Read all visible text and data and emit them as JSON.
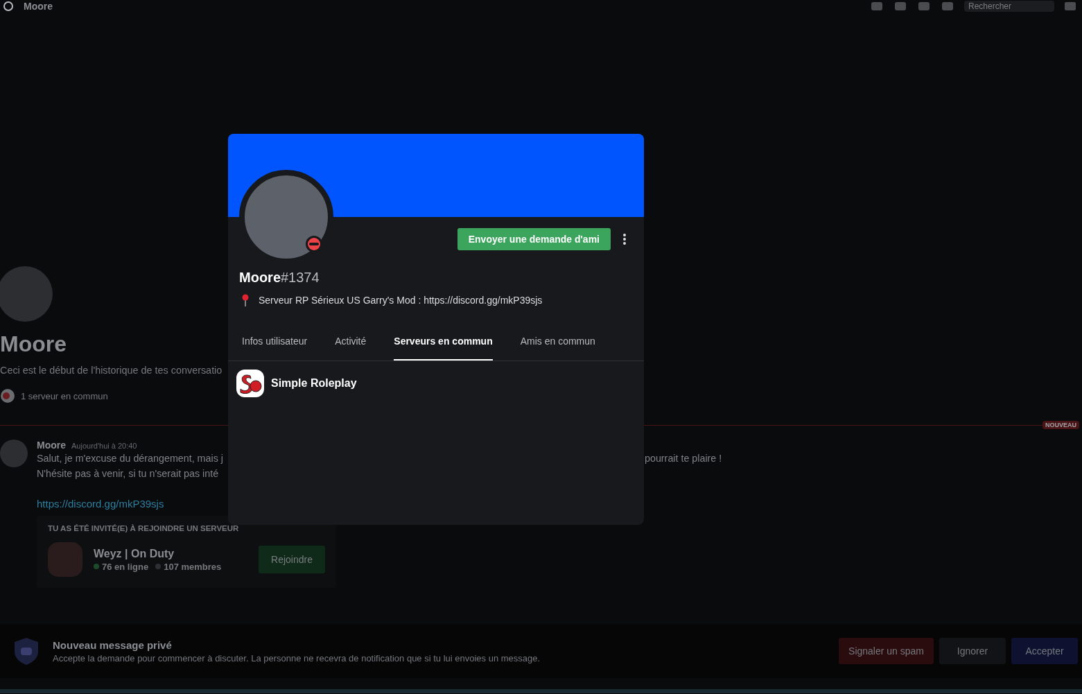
{
  "header": {
    "title": "Moore",
    "search": {
      "placeholder": "Rechercher"
    }
  },
  "dm_intro": {
    "name": "Moore",
    "description": "Ceci est le début de l'historique de tes conversatio",
    "mutual": "1 serveur en commun"
  },
  "divider_badge": "NOUVEAU",
  "message": {
    "author": "Moore",
    "time": "Aujourd'hui à 20:40",
    "lines": [
      {
        "left": "Salut, je m'excuse du dérangement, mais j",
        "right": "pourrait te plaire !"
      },
      {
        "left": "N'hésite pas à venir, si tu n'serait pas inté"
      }
    ],
    "link": "https://discord.gg/mkP39sjs",
    "invite": {
      "heading": "TU AS ÉTÉ INVITÉ(E) À REJOINDRE UN SERVEUR",
      "server": "Weyz | On Duty",
      "online": "76 en ligne",
      "members": "107 membres",
      "button": "Rejoindre"
    }
  },
  "request_bar": {
    "title": "Nouveau message privé",
    "text": "Accepte la demande pour commencer à discuter. La personne ne recevra de notification que si tu lui envoies un message.",
    "buttons": [
      {
        "label": "Signaler un spam",
        "kind": "danger"
      },
      {
        "label": "Ignorer",
        "kind": "secondary"
      },
      {
        "label": "Accepter",
        "kind": "primary"
      }
    ]
  },
  "profile": {
    "do_not_disturb": true,
    "button": "Envoyer une demande d'ami",
    "username": "Moore",
    "discriminator": "#1374",
    "custom_status": "Serveur RP Sérieux US Garry's Mod : https://discord.gg/mkP39sjs",
    "tabs": [
      {
        "label": "Infos utilisateur",
        "selected": false
      },
      {
        "label": "Activité",
        "selected": false
      },
      {
        "label": "Serveurs en commun",
        "selected": true
      },
      {
        "label": "Amis en commun",
        "selected": false
      }
    ],
    "servers": [
      {
        "name": "Simple Roleplay"
      }
    ]
  }
}
